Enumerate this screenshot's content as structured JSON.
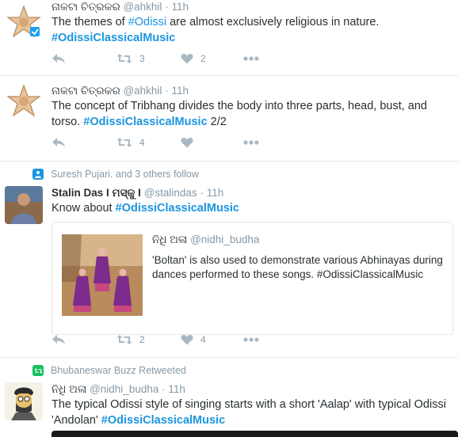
{
  "colors": {
    "link": "#1b95e0",
    "muted": "#8899a6",
    "text": "#292f33",
    "retweet_green": "#17bf63",
    "follow_blue": "#1b95e0"
  },
  "tweets": [
    {
      "name": "ନାକଟା ଚିତ୍ରକର",
      "handle": "@ahkhil",
      "sep": "·",
      "time": "11h",
      "text_before": "The themes of ",
      "hashtag1": "#Odissi",
      "text_after": " are almost exclusively religious in nature.",
      "hashtag2": "#OdissiClassicalMusic",
      "retweets": "3",
      "likes": "2"
    },
    {
      "name": "ନାକଟା ଚିତ୍ରକର",
      "handle": "@ahkhil",
      "sep": "·",
      "time": "11h",
      "text_line1": "The concept of Tribhang divides the body into three parts, head, bust, and",
      "text_line2_before": "torso. ",
      "hashtag": "#OdissiClassicalMusic",
      "text_line2_after": " 2/2",
      "retweets": "4",
      "likes": ""
    },
    {
      "context": "Suresh Pujari. and 3 others follow",
      "name": "Stalin Das I ମସ୍କୁ I",
      "handle": "@stalindas",
      "sep": "·",
      "time": "11h",
      "text_before": "Know about ",
      "hashtag": "#OdissiClassicalMusic",
      "quote": {
        "name": "ନିଧି ଅଳା",
        "handle": "@nidhi_budha",
        "text": "'Boltan' is also used to demonstrate various Abhinayas during dances performed to these songs. #OdissiClassicalMusic"
      },
      "retweets": "2",
      "likes": "4"
    },
    {
      "context": "Bhubaneswar Buzz Retweeted",
      "name": "ନିଧି ଅଳା",
      "handle": "@nidhi_budha",
      "sep": "·",
      "time": "11h",
      "text_line1": "The typical Odissi style of singing starts with a short 'Aalap' with typical Odissi",
      "text_line2_before": "'Andolan' ",
      "hashtag": "#OdissiClassicalMusic"
    }
  ],
  "icons": {
    "reply": "reply-icon",
    "retweet": "retweet-icon",
    "like": "heart-icon",
    "more": "more-dots-icon"
  }
}
